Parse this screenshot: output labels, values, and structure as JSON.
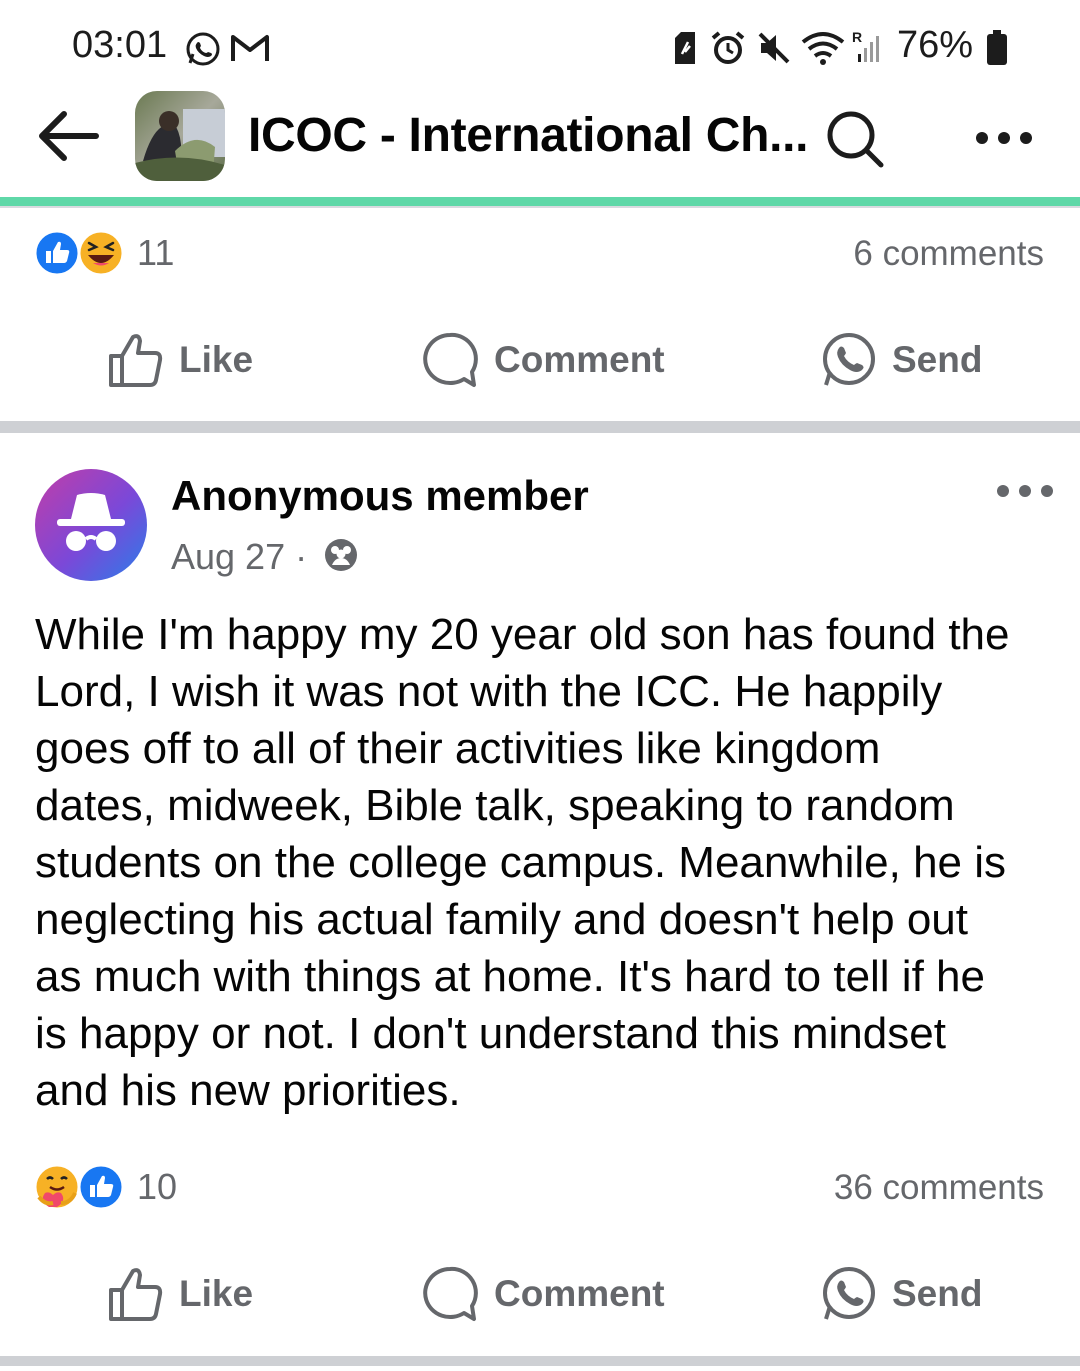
{
  "status_bar": {
    "time": "03:01",
    "battery": "76%",
    "left_icons": [
      "whatsapp-icon",
      "gmail-icon"
    ],
    "right_icons": [
      "sim-icon",
      "alarm-icon",
      "mute-icon",
      "wifi-icon",
      "signal-icon",
      "battery-icon"
    ]
  },
  "header": {
    "title": "ICOC - International Ch...",
    "avatar_icon": "group-cover-image"
  },
  "previous_post": {
    "reactions": {
      "icons": [
        "like",
        "haha"
      ],
      "count": "11"
    },
    "comments": "6 comments",
    "actions": {
      "like": "Like",
      "comment": "Comment",
      "send": "Send"
    }
  },
  "post": {
    "author": "Anonymous member",
    "date": "Aug 27 ·",
    "privacy_icon": "group-privacy-icon",
    "body": "While I'm happy my 20 year old son has found the\nLord, I wish it was not with the ICC. He happily\ngoes off to all of their activities like kingdom\ndates, midweek, Bible talk, speaking to random\nstudents on the college campus. Meanwhile, he is\nneglecting his actual family and doesn't help out\nas much with things at home. It's hard to tell if he\nis happy or not. I don't understand this mindset\nand his new priorities.",
    "reactions": {
      "icons": [
        "care",
        "like"
      ],
      "count": "10"
    },
    "comments": "36 comments",
    "actions": {
      "like": "Like",
      "comment": "Comment",
      "send": "Send"
    }
  },
  "colors": {
    "accent_progress": "#5fd8a8",
    "like_blue": "#1877f2",
    "secondary_text": "#65676b",
    "separator": "#ced0d4"
  }
}
